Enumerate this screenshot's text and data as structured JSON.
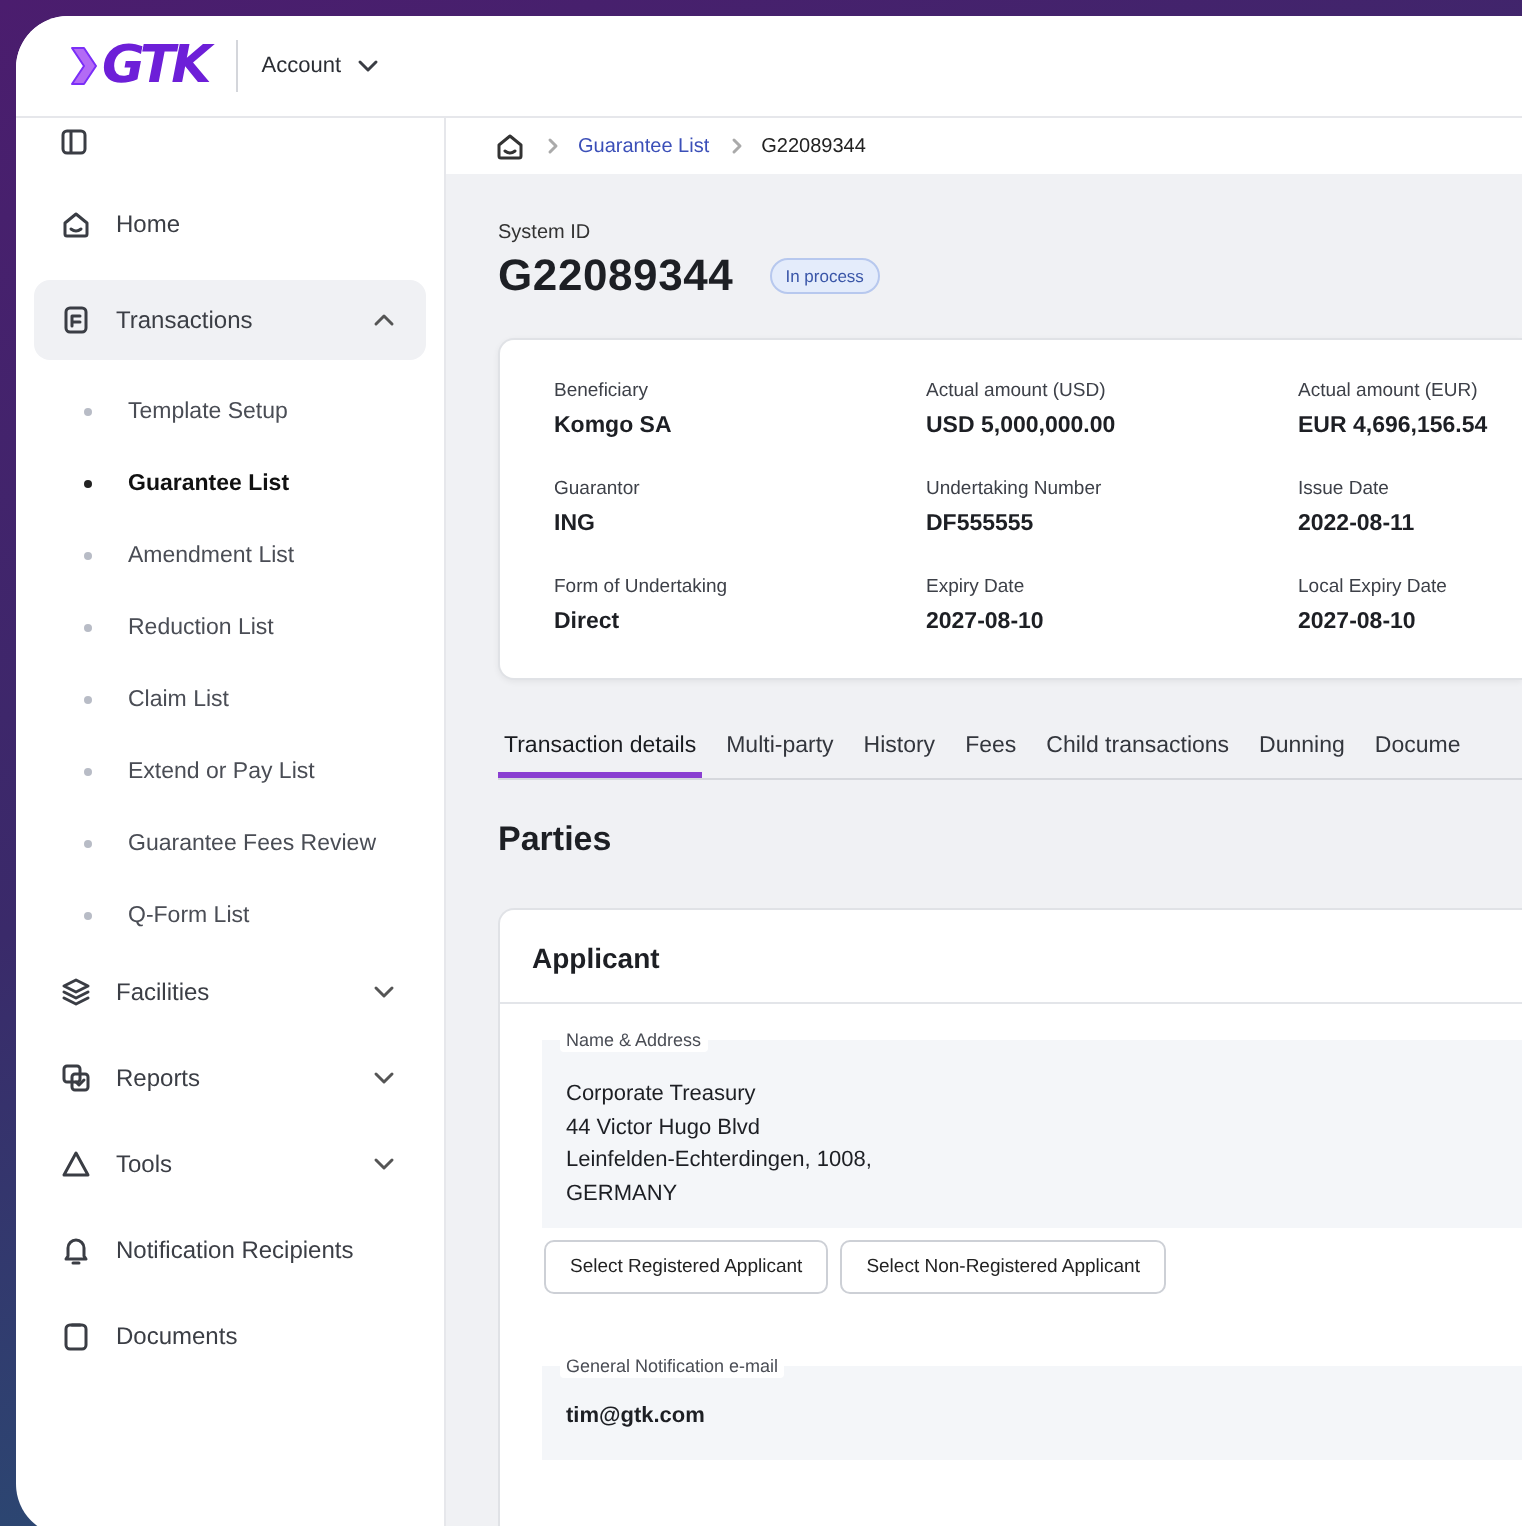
{
  "header": {
    "logo": "GTK",
    "account_menu": "Account"
  },
  "sidebar": {
    "items": [
      {
        "kind": "link",
        "label": "Home"
      },
      {
        "kind": "group",
        "label": "Transactions",
        "expanded": true,
        "children": [
          {
            "label": "Template Setup",
            "selected": false
          },
          {
            "label": "Guarantee List",
            "selected": true
          },
          {
            "label": "Amendment List",
            "selected": false
          },
          {
            "label": "Reduction List",
            "selected": false
          },
          {
            "label": "Claim List",
            "selected": false
          },
          {
            "label": "Extend or Pay List",
            "selected": false
          },
          {
            "label": "Guarantee Fees Review",
            "selected": false
          },
          {
            "label": "Q-Form List",
            "selected": false
          }
        ]
      },
      {
        "kind": "group",
        "label": "Facilities",
        "expanded": false
      },
      {
        "kind": "group",
        "label": "Reports",
        "expanded": false
      },
      {
        "kind": "group",
        "label": "Tools",
        "expanded": false
      },
      {
        "kind": "link",
        "label": "Notification Recipients"
      },
      {
        "kind": "link",
        "label": "Documents"
      }
    ]
  },
  "breadcrumb": [
    {
      "kind": "link",
      "label": "Guarantee List"
    },
    {
      "kind": "current",
      "label": "G22089344"
    }
  ],
  "summary": {
    "system_id_label": "System ID",
    "system_id": "G22089344",
    "status": "In process",
    "fields": [
      {
        "label": "Beneficiary",
        "value": "Komgo SA"
      },
      {
        "label": "Actual amount (USD)",
        "value": "USD 5,000,000.00"
      },
      {
        "label": "Actual amount (EUR)",
        "value": "EUR 4,696,156.54"
      },
      {
        "label": "Guarantor",
        "value": "ING"
      },
      {
        "label": "Undertaking Number",
        "value": "DF555555"
      },
      {
        "label": "Issue Date",
        "value": "2022-08-11"
      },
      {
        "label": "Form of Undertaking",
        "value": "Direct"
      },
      {
        "label": "Expiry Date",
        "value": "2027-08-10"
      },
      {
        "label": "Local Expiry Date",
        "value": "2027-08-10"
      }
    ]
  },
  "tabs": [
    {
      "label": "Transaction details",
      "selected": true
    },
    {
      "label": "Multi-party",
      "selected": false
    },
    {
      "label": "History",
      "selected": false
    },
    {
      "label": "Fees",
      "selected": false
    },
    {
      "label": "Child transactions",
      "selected": false
    },
    {
      "label": "Dunning",
      "selected": false
    },
    {
      "label": "Docume",
      "selected": false
    }
  ],
  "section_title": "Parties",
  "applicant": {
    "title": "Applicant",
    "name_address": {
      "label": "Name & Address",
      "lines": [
        "Corporate Treasury",
        "44 Victor Hugo Blvd",
        "Leinfelden-Echterdingen, 1008,",
        "GERMANY"
      ]
    },
    "buttons": [
      "Select Registered Applicant",
      "Select Non-Registered Applicant"
    ],
    "email": {
      "label": "General Notification e-mail",
      "value": "tim@gtk.com"
    }
  }
}
